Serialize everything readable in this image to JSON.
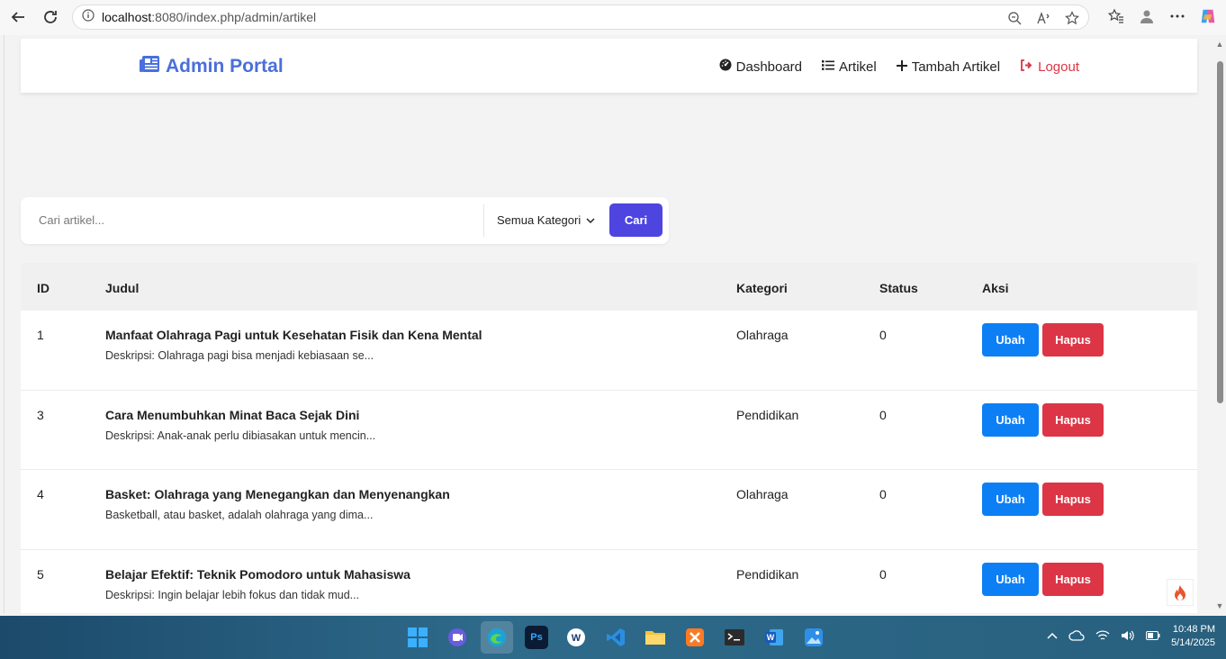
{
  "browser": {
    "url_host": "localhost",
    "url_rest": ":8080/index.php/admin/artikel"
  },
  "navbar": {
    "brand": "Admin Portal",
    "links": [
      {
        "label": "Dashboard",
        "icon": "dashboard-icon"
      },
      {
        "label": "Artikel",
        "icon": "list-icon"
      },
      {
        "label": "Tambah Artikel",
        "icon": "plus-icon"
      },
      {
        "label": "Logout",
        "icon": "logout-icon"
      }
    ]
  },
  "search": {
    "placeholder": "Cari artikel...",
    "category_selected": "Semua Kategori",
    "button": "Cari"
  },
  "table": {
    "headers": [
      "ID",
      "Judul",
      "Kategori",
      "Status",
      "Aksi"
    ],
    "rows": [
      {
        "id": "1",
        "title": "Manfaat Olahraga Pagi untuk Kesehatan Fisik dan Kena Mental",
        "desc": "Deskripsi: Olahraga pagi bisa menjadi kebiasaan se...",
        "kategori": "Olahraga",
        "status": "0"
      },
      {
        "id": "3",
        "title": "Cara Menumbuhkan Minat Baca Sejak Dini",
        "desc": "Deskripsi: Anak-anak perlu dibiasakan untuk mencin...",
        "kategori": "Pendidikan",
        "status": "0"
      },
      {
        "id": "4",
        "title": "Basket: Olahraga yang Menegangkan dan Menyenangkan",
        "desc": "Basketball, atau basket, adalah olahraga yang dima...",
        "kategori": "Olahraga",
        "status": "0"
      },
      {
        "id": "5",
        "title": "Belajar Efektif: Teknik Pomodoro untuk Mahasiswa",
        "desc": "Deskripsi: Ingin belajar lebih fokus dan tidak mud...",
        "kategori": "Pendidikan",
        "status": "0"
      }
    ],
    "edit_label": "Ubah",
    "delete_label": "Hapus"
  },
  "taskbar": {
    "time": "10:48 PM",
    "date": "5/14/2025"
  },
  "colors": {
    "brand": "#4a6fdc",
    "primary": "#4e44e0",
    "edit": "#0d7ff5",
    "danger": "#dc3545"
  }
}
